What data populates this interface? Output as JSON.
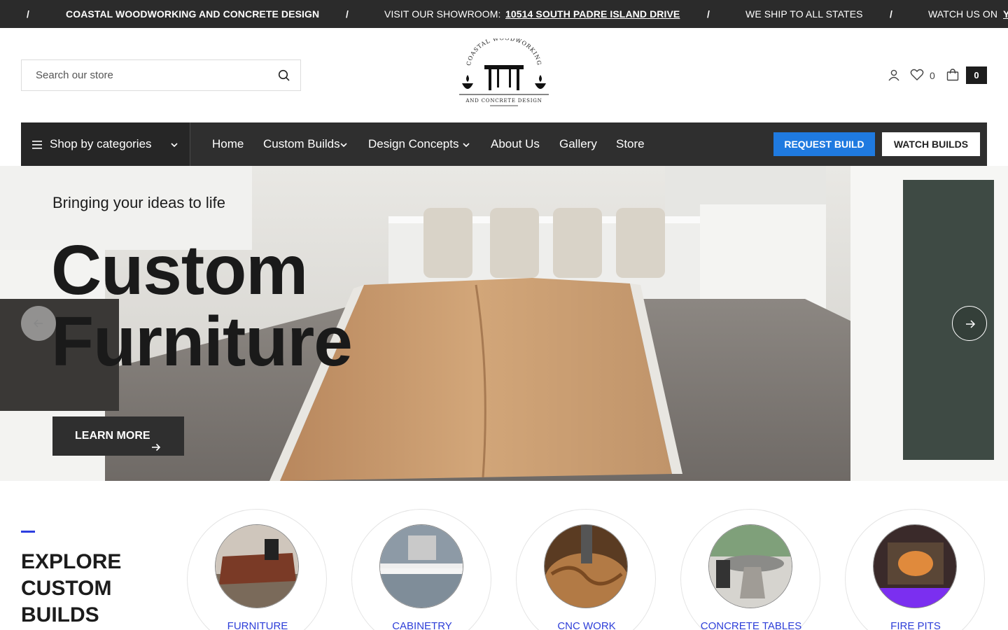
{
  "announcement": {
    "separator": "/",
    "brand": "COASTAL WOODWORKING AND CONCRETE DESIGN",
    "showroom_label": "VISIT OUR SHOWROOM:",
    "showroom_address": "10514 SOUTH PADRE ISLAND DRIVE",
    "shipping": "WE SHIP TO ALL STATES",
    "watch": "WATCH US ON",
    "watch_platform": "Y"
  },
  "search": {
    "placeholder": "Search our store"
  },
  "logo": {
    "top_text": "COASTAL WOODWORKING",
    "bottom_text": "AND CONCRETE DESIGN"
  },
  "header": {
    "wishlist_count": "0",
    "cart_count": "0"
  },
  "nav": {
    "categories_label": "Shop by categories",
    "links": [
      "Home",
      "Custom Builds",
      "Design Concepts",
      "About Us",
      "Gallery",
      "Store"
    ],
    "request_button": "REQUEST BUILD",
    "watch_button": "WATCH BUILDS"
  },
  "hero": {
    "subtitle": "Bringing your ideas to life",
    "title_line1": "Custom",
    "title_line2": "Furniture",
    "cta": "LEARN MORE"
  },
  "explore": {
    "title_lines": [
      "EXPLORE",
      "CUSTOM",
      "BUILDS"
    ],
    "categories": [
      "FURNITURE",
      "CABINETRY",
      "CNC WORK",
      "CONCRETE TABLES",
      "FIRE PITS"
    ]
  },
  "colors": {
    "accent_blue": "#1f7ae0",
    "link_blue": "#2d3ed8",
    "dark": "#2f2f2f"
  }
}
